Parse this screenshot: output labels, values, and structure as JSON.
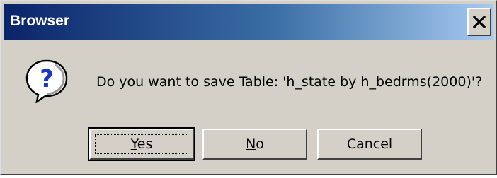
{
  "window": {
    "title": "Browser",
    "close_glyph": "✕"
  },
  "dialog": {
    "icon": "question-icon",
    "message": "Do you want to save Table: 'h_state by h_bedrms(2000)'?"
  },
  "buttons": {
    "yes": {
      "mnemonic": "Y",
      "rest": "es"
    },
    "no": {
      "mnemonic": "N",
      "rest": "o"
    },
    "cancel": {
      "label": "Cancel"
    }
  },
  "colors": {
    "title_gradient_start": "#0a246a",
    "title_gradient_end": "#a6caf0",
    "face": "#d4d0c8"
  }
}
